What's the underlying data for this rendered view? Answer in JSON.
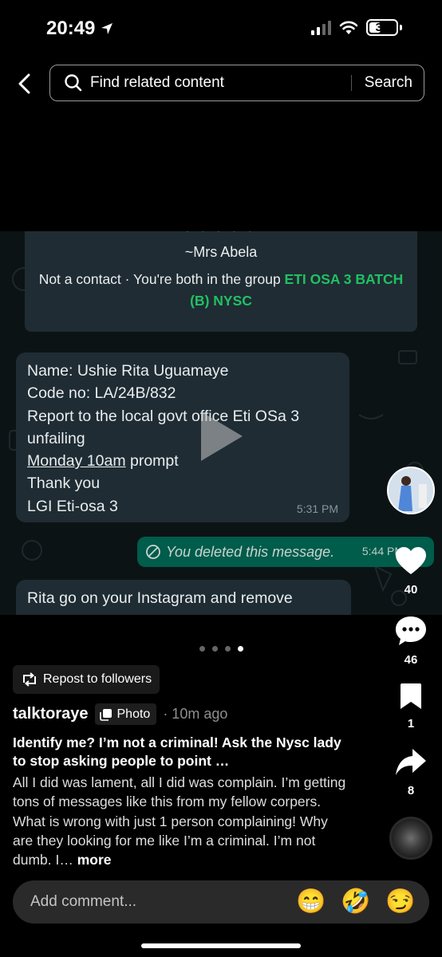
{
  "status_bar": {
    "time": "20:49",
    "battery": "39"
  },
  "search": {
    "placeholder": "Find related content",
    "button": "Search"
  },
  "screenshot": {
    "contact_name": "~Mrs Abela",
    "contact_info_prefix": "Not a contact · You're both in the group ",
    "group_name": "ETI OSA 3 BATCH (B) NYSC",
    "message1": {
      "line1": "Name: Ushie Rita Uguamaye",
      "line2": "Code no: LA/24B/832",
      "line3": "Report to the local govt office Eti OSa 3",
      "line4": "unfailing",
      "line5_underlined": "Monday 10am",
      "line5_rest": " prompt",
      "line6": "Thank you",
      "line7": "LGI Eti-osa 3",
      "time": "5:31 PM"
    },
    "message2": {
      "text": "You deleted this message.",
      "time": "5:44 PM"
    },
    "message3": {
      "text": "Rita go on your Instagram and remove"
    }
  },
  "actions": {
    "likes": "40",
    "comments": "46",
    "bookmarks": "1",
    "shares": "8"
  },
  "carousel": {
    "pages": 4,
    "active_page": 4
  },
  "post": {
    "repost_label": "Repost to followers",
    "author": "talktoraye",
    "type_badge": "Photo",
    "time_ago": "· 10m ago",
    "title": "Identify me? I’m not a criminal! Ask the Nysc lady to stop asking people to point …",
    "body": "All I did was lament, all I did was complain. I’m getting tons of messages like this from my fellow corpers. What is wrong with just 1 person complaining! Why are they looking for me like I’m a criminal. I’m not dumb. I…",
    "more": "more"
  },
  "comment_bar": {
    "placeholder": "Add comment...",
    "emojis": [
      "😁",
      "🤣",
      "😏"
    ]
  }
}
